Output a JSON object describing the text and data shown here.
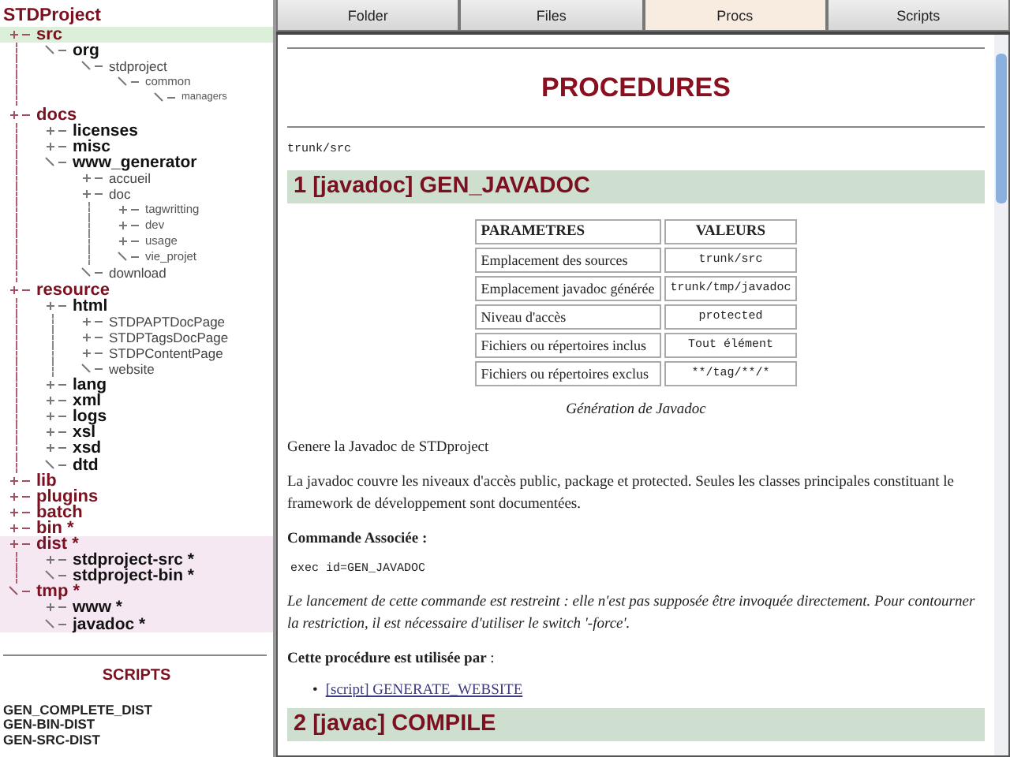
{
  "sidebar": {
    "title": "STDProject",
    "tree": [
      {
        "name": "src",
        "selected": true,
        "highlighted": false,
        "children": [
          {
            "name": "org",
            "selected": false,
            "highlighted": false,
            "children": [
              {
                "name": "stdproject",
                "selected": false,
                "highlighted": false,
                "children": [
                  {
                    "name": "common",
                    "selected": false,
                    "highlighted": false,
                    "children": [
                      {
                        "name": "managers",
                        "selected": false,
                        "highlighted": false
                      }
                    ]
                  }
                ]
              }
            ]
          }
        ]
      },
      {
        "name": "docs",
        "selected": false,
        "highlighted": false,
        "children": [
          {
            "name": "licenses",
            "selected": false,
            "highlighted": false
          },
          {
            "name": "misc",
            "selected": false,
            "highlighted": false
          },
          {
            "name": "www_generator",
            "selected": false,
            "highlighted": false,
            "children": [
              {
                "name": "accueil",
                "selected": false,
                "highlighted": false
              },
              {
                "name": "doc",
                "selected": false,
                "highlighted": false,
                "children": [
                  {
                    "name": "tagwritting",
                    "selected": false,
                    "highlighted": false
                  },
                  {
                    "name": "dev",
                    "selected": false,
                    "highlighted": false
                  },
                  {
                    "name": "usage",
                    "selected": false,
                    "highlighted": false
                  },
                  {
                    "name": "vie_projet",
                    "selected": false,
                    "highlighted": false
                  }
                ]
              },
              {
                "name": "download",
                "selected": false,
                "highlighted": false
              }
            ]
          }
        ]
      },
      {
        "name": "resource",
        "selected": false,
        "highlighted": false,
        "children": [
          {
            "name": "html",
            "selected": false,
            "highlighted": false,
            "children": [
              {
                "name": "STDPAPTDocPage",
                "selected": false,
                "highlighted": false
              },
              {
                "name": "STDPTagsDocPage",
                "selected": false,
                "highlighted": false
              },
              {
                "name": "STDPContentPage",
                "selected": false,
                "highlighted": false
              },
              {
                "name": "website",
                "selected": false,
                "highlighted": false
              }
            ]
          },
          {
            "name": "lang",
            "selected": false,
            "highlighted": false
          },
          {
            "name": "xml",
            "selected": false,
            "highlighted": false
          },
          {
            "name": "logs",
            "selected": false,
            "highlighted": false
          },
          {
            "name": "xsl",
            "selected": false,
            "highlighted": false
          },
          {
            "name": "xsd",
            "selected": false,
            "highlighted": false
          },
          {
            "name": "dtd",
            "selected": false,
            "highlighted": false
          }
        ]
      },
      {
        "name": "lib",
        "selected": false,
        "highlighted": false
      },
      {
        "name": "plugins",
        "selected": false,
        "highlighted": false
      },
      {
        "name": "batch",
        "selected": false,
        "highlighted": false
      },
      {
        "name": "bin *",
        "selected": false,
        "highlighted": false
      },
      {
        "name": "dist *",
        "selected": false,
        "highlighted": true,
        "children": [
          {
            "name": "stdproject-src *",
            "selected": false,
            "highlighted": true
          },
          {
            "name": "stdproject-bin *",
            "selected": false,
            "highlighted": true
          }
        ]
      },
      {
        "name": "tmp *",
        "selected": false,
        "highlighted": true,
        "children": [
          {
            "name": "www *",
            "selected": false,
            "highlighted": true
          },
          {
            "name": "javadoc *",
            "selected": false,
            "highlighted": true
          }
        ]
      }
    ],
    "scripts_heading": "SCRIPTS",
    "scripts": [
      "GEN_COMPLETE_DIST",
      "GEN-BIN-DIST",
      "GEN-SRC-DIST"
    ]
  },
  "tabs": [
    {
      "label": "Folder",
      "selected": false
    },
    {
      "label": "Files",
      "selected": false
    },
    {
      "label": "Procs",
      "selected": true
    },
    {
      "label": "Scripts",
      "selected": false
    }
  ],
  "content": {
    "title": "PROCEDURES",
    "path": "trunk/src",
    "blocks": [
      {
        "kind": "heading",
        "text": "1 [javadoc] GEN_JAVADOC"
      },
      {
        "kind": "table",
        "columns": [
          "PARAMETRES",
          "VALEURS"
        ],
        "rows": [
          [
            "Emplacement des sources",
            "trunk/src"
          ],
          [
            "Emplacement javadoc générée",
            "trunk/tmp/javadoc"
          ],
          [
            "Niveau d'accès",
            "protected"
          ],
          [
            "Fichiers ou répertoires inclus",
            "Tout élément"
          ],
          [
            "Fichiers ou répertoires exclus",
            "**/tag/**/*"
          ]
        ]
      },
      {
        "kind": "caption",
        "text": "Génération de Javadoc"
      },
      {
        "kind": "paragraph",
        "text": "Genere la Javadoc de STDproject"
      },
      {
        "kind": "paragraph",
        "text": "La javadoc couvre les niveaux d'accès public, package et protected. Seules les classes principales constituant le framework de développement sont documentées."
      },
      {
        "kind": "label",
        "text": "Commande Associée :"
      },
      {
        "kind": "code",
        "text": "exec id=GEN_JAVADOC"
      },
      {
        "kind": "note",
        "text": "Le lancement de cette commande est restreint : elle n'est pas supposée être invoquée directement. Pour contourner la restriction, il est nécessaire d'utiliser le switch '-force'."
      },
      {
        "kind": "paragraph",
        "text": "**Cette procédure est utilisée par** :"
      },
      {
        "kind": "links",
        "items": [
          {
            "bullet": "•",
            "text": "[script] GENERATE_WEBSITE"
          }
        ]
      },
      {
        "kind": "heading",
        "text": "2 [javac] COMPILE"
      }
    ]
  }
}
